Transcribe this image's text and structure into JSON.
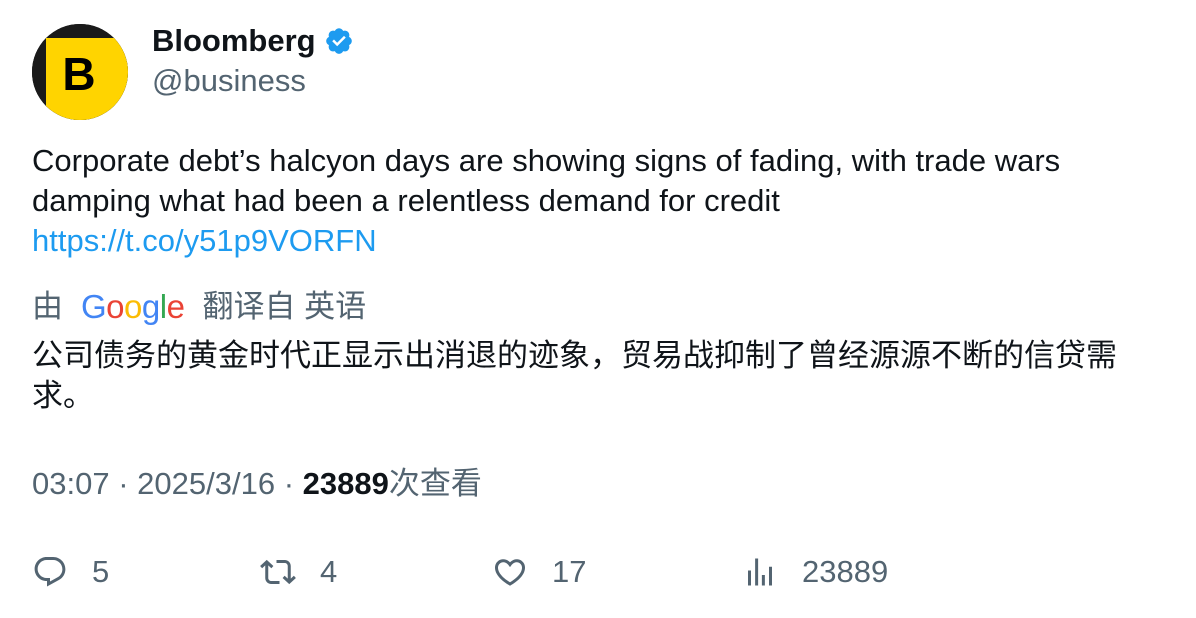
{
  "author": {
    "display_name": "Bloomberg",
    "handle": "@business",
    "verified": true,
    "avatar_letter": "B",
    "avatar_color": "#ffd400",
    "verified_color": "#1d9bf0"
  },
  "tweet": {
    "text": "Corporate debt’s halcyon days are showing signs of fading, with trade wars damping what had been a relentless demand for credit",
    "link": "https://t.co/y51p9VORFN"
  },
  "translation": {
    "by_label": "由",
    "provider": "Google",
    "translated_label": "翻译自 英语",
    "text": "公司债务的黄金时代正显示出消退的迹象，贸易战抑制了曾经源源不断的信贷需求。"
  },
  "meta": {
    "time": "03:07",
    "separator": "·",
    "date": "2025/3/16",
    "views_count": "23889",
    "views_label": "次查看"
  },
  "actions": {
    "replies": "5",
    "retweets": "4",
    "likes": "17",
    "views": "23889"
  },
  "icons": {
    "reply": "reply-icon",
    "retweet": "retweet-icon",
    "like": "heart-icon",
    "views": "analytics-icon",
    "verified": "verified-badge-icon"
  }
}
